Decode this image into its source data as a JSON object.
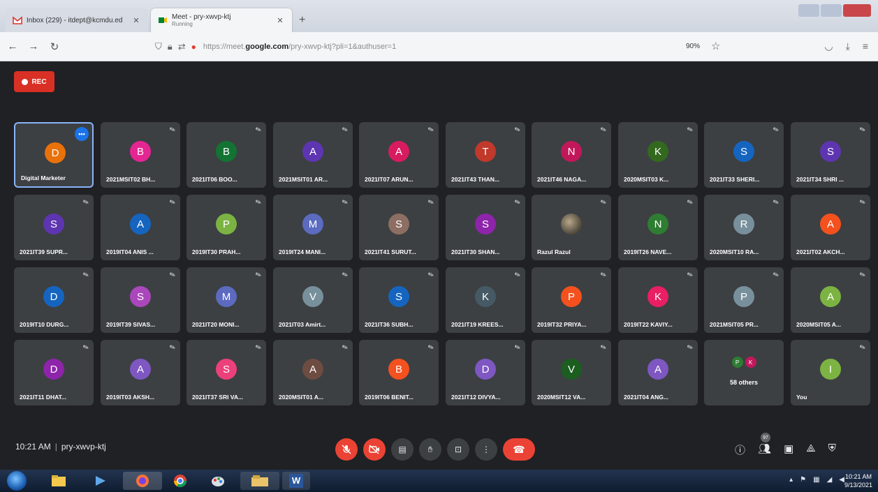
{
  "browser": {
    "tabs": [
      {
        "title": "Inbox (229) - itdept@kcmdu.ed",
        "subtitle": "",
        "active": false
      },
      {
        "title": "Meet - pry-xwvp-ktj",
        "subtitle": "Running",
        "active": true
      }
    ],
    "new_tab": "+",
    "nav": {
      "back": "←",
      "forward": "→",
      "reload": "↻"
    },
    "url_prefix": "https://meet.",
    "url_domain": "google.com",
    "url_path": "/pry-xwvp-ktj?pli=1&authuser=1",
    "zoom": "90%"
  },
  "meet": {
    "rec_label": "REC",
    "more_label": "•••",
    "mic_off_glyph": "✎",
    "participants": [
      {
        "initial": "D",
        "name": "Digital Marketer",
        "color": "#e8710a",
        "active": true
      },
      {
        "initial": "B",
        "name": "2021MSIT02 BH...",
        "color": "#e52592"
      },
      {
        "initial": "B",
        "name": "2021IT06 BOO...",
        "color": "#137333"
      },
      {
        "initial": "A",
        "name": "2021MSIT01 AR...",
        "color": "#5e35b1"
      },
      {
        "initial": "A",
        "name": "2021IT07 ARUN...",
        "color": "#d81b60"
      },
      {
        "initial": "T",
        "name": "2021IT43 THAN...",
        "color": "#c0392b"
      },
      {
        "initial": "N",
        "name": "2021IT46 NAGA...",
        "color": "#c2185b"
      },
      {
        "initial": "K",
        "name": "2020MSIT03 K...",
        "color": "#33691e"
      },
      {
        "initial": "S",
        "name": "2021IT33 SHERI...",
        "color": "#1565c0"
      },
      {
        "initial": "S",
        "name": "2021IT34 SHRI ...",
        "color": "#5e35b1"
      },
      {
        "initial": "S",
        "name": "2021IT39 SUPR...",
        "color": "#5e35b1"
      },
      {
        "initial": "A",
        "name": "2019IT04 ANIS ...",
        "color": "#1565c0"
      },
      {
        "initial": "P",
        "name": "2019IT30 PRAH...",
        "color": "#7cb342"
      },
      {
        "initial": "M",
        "name": "2019IT24 MANI...",
        "color": "#5c6bc0"
      },
      {
        "initial": "S",
        "name": "2021IT41 SURUT...",
        "color": "#8d6e63"
      },
      {
        "initial": "S",
        "name": "2021IT30 SHAN...",
        "color": "#8e24aa"
      },
      {
        "initial": "",
        "name": "Razul Razul",
        "color": "#6d6250",
        "photo": true
      },
      {
        "initial": "N",
        "name": "2019IT26 NAVE...",
        "color": "#2e7d32"
      },
      {
        "initial": "R",
        "name": "2020MSIT10 RA...",
        "color": "#78909c"
      },
      {
        "initial": "A",
        "name": "2021IT02 AKCH...",
        "color": "#f4511e"
      },
      {
        "initial": "D",
        "name": "2019IT10 DURG...",
        "color": "#1565c0"
      },
      {
        "initial": "S",
        "name": "2019IT39 SIVAS...",
        "color": "#ab47bc"
      },
      {
        "initial": "M",
        "name": "2021IT20 MONI...",
        "color": "#5c6bc0"
      },
      {
        "initial": "V",
        "name": "2021IT03 Amirt...",
        "color": "#78909c"
      },
      {
        "initial": "S",
        "name": "2021IT36 SUBH...",
        "color": "#1565c0"
      },
      {
        "initial": "K",
        "name": "2021IT19 KREES...",
        "color": "#455a64"
      },
      {
        "initial": "P",
        "name": "2019IT32 PRIYA...",
        "color": "#f4511e"
      },
      {
        "initial": "K",
        "name": "2019IT22 KAVIY...",
        "color": "#e91e63"
      },
      {
        "initial": "P",
        "name": "2021MSIT05 PR...",
        "color": "#78909c"
      },
      {
        "initial": "A",
        "name": "2020MSIT05 A...",
        "color": "#7cb342"
      },
      {
        "initial": "D",
        "name": "2021IT11 DHAT...",
        "color": "#8e24aa"
      },
      {
        "initial": "A",
        "name": "2019IT03 AKSH...",
        "color": "#7e57c2"
      },
      {
        "initial": "S",
        "name": "2021IT37 SRI VA...",
        "color": "#ec407a"
      },
      {
        "initial": "A",
        "name": "2020MSIT01 A...",
        "color": "#6d4c41"
      },
      {
        "initial": "B",
        "name": "2019IT06 BENIT...",
        "color": "#f4511e"
      },
      {
        "initial": "D",
        "name": "2021IT12 DIVYA...",
        "color": "#7e57c2"
      },
      {
        "initial": "V",
        "name": "2020MSIT12 VA...",
        "color": "#1b5e20"
      },
      {
        "initial": "A",
        "name": "2021IT04 ANG...",
        "color": "#7e57c2"
      }
    ],
    "others_tile": {
      "avatars": [
        {
          "initial": "P",
          "color": "#2e7d32"
        },
        {
          "initial": "K",
          "color": "#c2185b"
        }
      ],
      "label": "58 others"
    },
    "self_tile": {
      "initial": "I",
      "name": "You",
      "color": "#7cb342"
    },
    "time": "10:21 AM",
    "separator": "|",
    "meeting_code": "pry-xwvp-ktj",
    "people_count": "97"
  },
  "taskbar": {
    "word_label": "W",
    "clock_time": "10:21 AM",
    "clock_date": "9/13/2021"
  }
}
